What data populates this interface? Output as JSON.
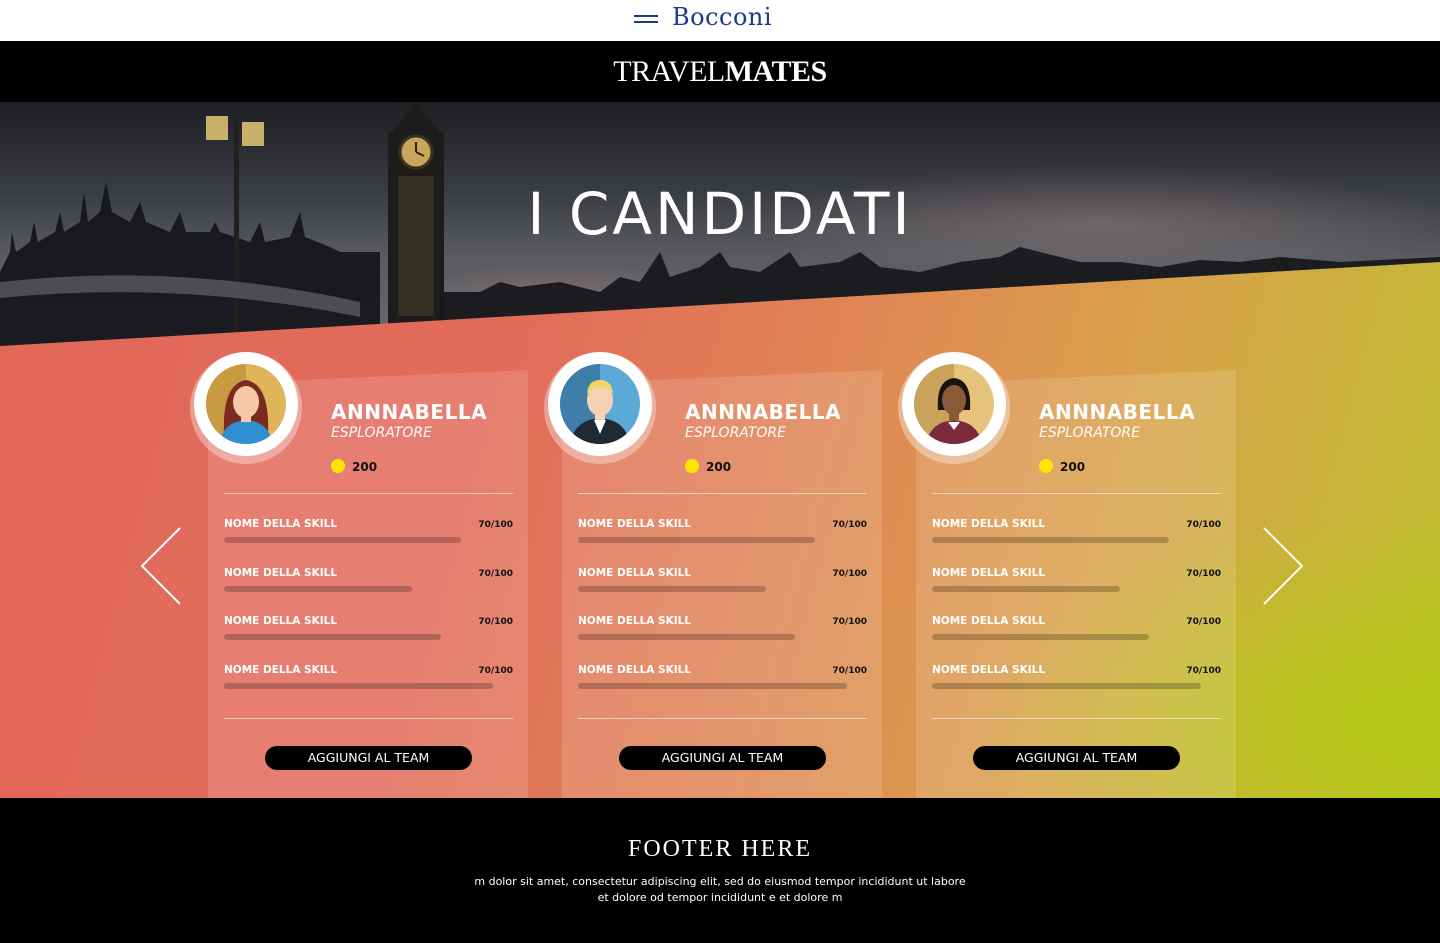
{
  "topbar": {
    "brand": "Bocconi",
    "menu_icon": "hamburger-icon"
  },
  "header": {
    "logo_light": "TRAVEL",
    "logo_bold": "MATES"
  },
  "hero": {
    "title": "I CANDIDATI"
  },
  "carousel": {
    "prev_icon": "chevron-left-icon",
    "next_icon": "chevron-right-icon"
  },
  "cards": [
    {
      "name": "ANNNABELLA",
      "role": "ESPLORATORE",
      "points": "200",
      "avatar": "woman-redhair-avatar",
      "skills": [
        {
          "label": "NOME DELLA SKILL",
          "value": "70/100",
          "level": 0.82
        },
        {
          "label": "NOME DELLA SKILL",
          "value": "70/100",
          "level": 0.65
        },
        {
          "label": "NOME DELLA SKILL",
          "value": "70/100",
          "level": 0.75
        },
        {
          "label": "NOME DELLA SKILL",
          "value": "70/100",
          "level": 0.93
        }
      ],
      "button": "AGGIUNGI AL TEAM"
    },
    {
      "name": "ANNNABELLA",
      "role": "ESPLORATORE",
      "points": "200",
      "avatar": "man-blond-avatar",
      "skills": [
        {
          "label": "NOME DELLA SKILL",
          "value": "70/100",
          "level": 0.82
        },
        {
          "label": "NOME DELLA SKILL",
          "value": "70/100",
          "level": 0.65
        },
        {
          "label": "NOME DELLA SKILL",
          "value": "70/100",
          "level": 0.75
        },
        {
          "label": "NOME DELLA SKILL",
          "value": "70/100",
          "level": 0.93
        }
      ],
      "button": "AGGIUNGI AL TEAM"
    },
    {
      "name": "ANNNABELLA",
      "role": "ESPLORATORE",
      "points": "200",
      "avatar": "woman-darkhair-avatar",
      "skills": [
        {
          "label": "NOME DELLA SKILL",
          "value": "70/100",
          "level": 0.82
        },
        {
          "label": "NOME DELLA SKILL",
          "value": "70/100",
          "level": 0.65
        },
        {
          "label": "NOME DELLA SKILL",
          "value": "70/100",
          "level": 0.75
        },
        {
          "label": "NOME DELLA SKILL",
          "value": "70/100",
          "level": 0.93
        }
      ],
      "button": "AGGIUNGI AL TEAM"
    }
  ],
  "footer": {
    "title": "FOOTER HERE",
    "text": "m dolor sit amet, consectetur adipiscing elit, sed do eiusmod tempor incididunt ut labore et dolore od tempor incididunt e et dolore m"
  },
  "colors": {
    "brand_blue": "#1b3a8c",
    "coin": "#ffe600",
    "hero_red": "#e2685a",
    "hero_green": "#bcc12a"
  }
}
